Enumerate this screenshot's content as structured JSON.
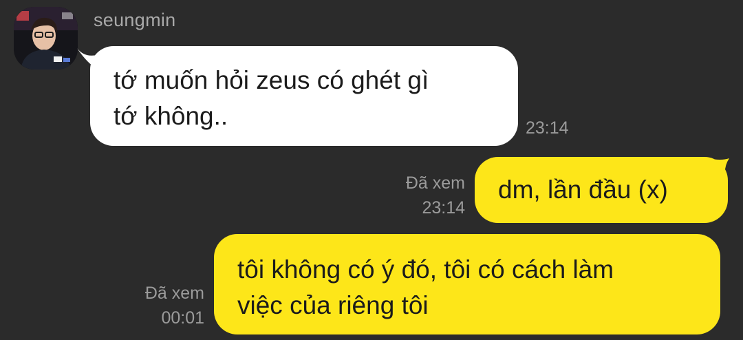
{
  "chat": {
    "sender_name": "seungmin",
    "messages": [
      {
        "direction": "incoming",
        "text": "tớ muốn hỏi zeus có ghét gì\ntớ không..",
        "time": "23:14"
      },
      {
        "direction": "outgoing",
        "text": "dm, lần đầu (x)",
        "read_status": "Đã xem",
        "time": "23:14"
      },
      {
        "direction": "outgoing",
        "text": "tôi không có ý đó, tôi có cách làm\nviệc của riêng tôi",
        "read_status": "Đã xem",
        "time": "00:01"
      }
    ]
  },
  "colors": {
    "background": "#2b2b2b",
    "incoming_bubble": "#ffffff",
    "outgoing_bubble": "#fde619",
    "meta_text": "#9b9b9b",
    "sender_name": "#a9a9a9"
  }
}
